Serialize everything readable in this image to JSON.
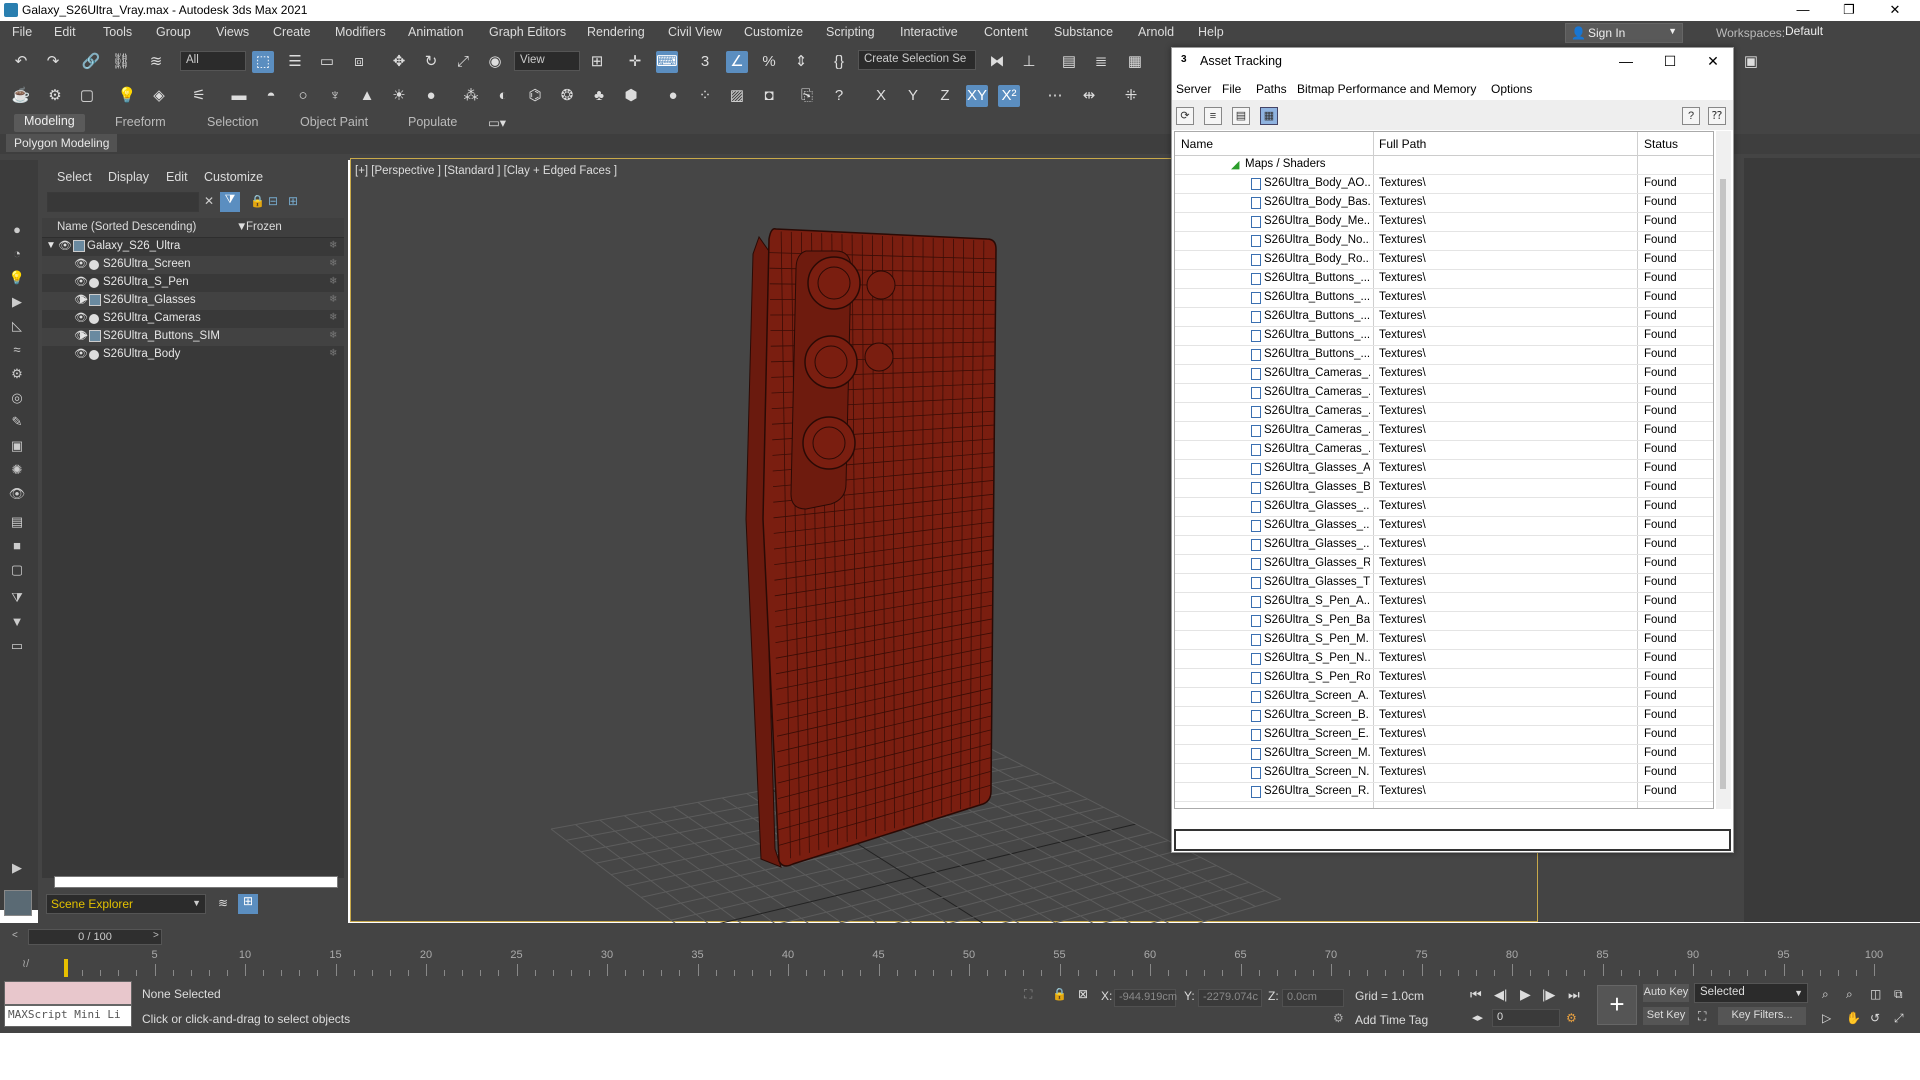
{
  "window": {
    "title": "Galaxy_S26Ultra_Vray.max - Autodesk 3ds Max 2021",
    "minimize": "—",
    "restore": "❐",
    "close": "✕"
  },
  "menu": [
    "File",
    "Edit",
    "Tools",
    "Group",
    "Views",
    "Create",
    "Modifiers",
    "Animation",
    "Graph Editors",
    "Rendering",
    "Civil View",
    "Customize",
    "Scripting",
    "Interactive",
    "Content",
    "Substance",
    "Arnold",
    "Help"
  ],
  "signin": "Sign In",
  "workspaces_label": "Workspaces:",
  "workspaces_value": "Default",
  "toolbar": {
    "filter_all": "All",
    "view_dd": "View",
    "selection_set": "Create Selection Se"
  },
  "ribbon_tabs": [
    "Modeling",
    "Freeform",
    "Selection",
    "Object Paint",
    "Populate"
  ],
  "ribbon_sub": "Polygon Modeling",
  "scene_explorer": {
    "menu": [
      "Select",
      "Display",
      "Edit",
      "Customize"
    ],
    "col_name": "Name (Sorted Descending)",
    "col_frozen": "Frozen",
    "rows": [
      {
        "label": "Galaxy_S26_Ultra",
        "level": 0,
        "expand": "▼",
        "type": "grp"
      },
      {
        "label": "S26Ultra_Screen",
        "level": 1,
        "type": "obj"
      },
      {
        "label": "S26Ultra_S_Pen",
        "level": 1,
        "type": "obj"
      },
      {
        "label": "S26Ultra_Glasses",
        "level": 1,
        "expand": "▶",
        "type": "grp"
      },
      {
        "label": "S26Ultra_Cameras",
        "level": 1,
        "type": "obj"
      },
      {
        "label": "S26Ultra_Buttons_SIM",
        "level": 1,
        "expand": "▶",
        "type": "grp"
      },
      {
        "label": "S26Ultra_Body",
        "level": 1,
        "type": "obj"
      }
    ],
    "footer": "Scene Explorer"
  },
  "viewport": {
    "label": "[+] [Perspective ] [Standard ] [Clay + Edged Faces ]"
  },
  "asset": {
    "title": "Asset Tracking",
    "menu": [
      "Server",
      "File",
      "Paths",
      "Bitmap Performance and Memory",
      "Options"
    ],
    "columns": [
      "Name",
      "Full Path",
      "Status"
    ],
    "group": "Maps / Shaders",
    "rows": [
      [
        "S26Ultra_Body_AO...",
        "Textures\\",
        "Found"
      ],
      [
        "S26Ultra_Body_Bas...",
        "Textures\\",
        "Found"
      ],
      [
        "S26Ultra_Body_Me...",
        "Textures\\",
        "Found"
      ],
      [
        "S26Ultra_Body_No...",
        "Textures\\",
        "Found"
      ],
      [
        "S26Ultra_Body_Ro...",
        "Textures\\",
        "Found"
      ],
      [
        "S26Ultra_Buttons_...",
        "Textures\\",
        "Found"
      ],
      [
        "S26Ultra_Buttons_...",
        "Textures\\",
        "Found"
      ],
      [
        "S26Ultra_Buttons_...",
        "Textures\\",
        "Found"
      ],
      [
        "S26Ultra_Buttons_...",
        "Textures\\",
        "Found"
      ],
      [
        "S26Ultra_Buttons_...",
        "Textures\\",
        "Found"
      ],
      [
        "S26Ultra_Cameras_...",
        "Textures\\",
        "Found"
      ],
      [
        "S26Ultra_Cameras_...",
        "Textures\\",
        "Found"
      ],
      [
        "S26Ultra_Cameras_...",
        "Textures\\",
        "Found"
      ],
      [
        "S26Ultra_Cameras_...",
        "Textures\\",
        "Found"
      ],
      [
        "S26Ultra_Cameras_...",
        "Textures\\",
        "Found"
      ],
      [
        "S26Ultra_Glasses_A...",
        "Textures\\",
        "Found"
      ],
      [
        "S26Ultra_Glasses_B...",
        "Textures\\",
        "Found"
      ],
      [
        "S26Ultra_Glasses_...",
        "Textures\\",
        "Found"
      ],
      [
        "S26Ultra_Glasses_...",
        "Textures\\",
        "Found"
      ],
      [
        "S26Ultra_Glasses_...",
        "Textures\\",
        "Found"
      ],
      [
        "S26Ultra_Glasses_R...",
        "Textures\\",
        "Found"
      ],
      [
        "S26Ultra_Glasses_T...",
        "Textures\\",
        "Found"
      ],
      [
        "S26Ultra_S_Pen_A...",
        "Textures\\",
        "Found"
      ],
      [
        "S26Ultra_S_Pen_Ba...",
        "Textures\\",
        "Found"
      ],
      [
        "S26Ultra_S_Pen_M...",
        "Textures\\",
        "Found"
      ],
      [
        "S26Ultra_S_Pen_N...",
        "Textures\\",
        "Found"
      ],
      [
        "S26Ultra_S_Pen_Ro...",
        "Textures\\",
        "Found"
      ],
      [
        "S26Ultra_Screen_A...",
        "Textures\\",
        "Found"
      ],
      [
        "S26Ultra_Screen_B...",
        "Textures\\",
        "Found"
      ],
      [
        "S26Ultra_Screen_E...",
        "Textures\\",
        "Found"
      ],
      [
        "S26Ultra_Screen_M...",
        "Textures\\",
        "Found"
      ],
      [
        "S26Ultra_Screen_N...",
        "Textures\\",
        "Found"
      ],
      [
        "S26Ultra_Screen_R...",
        "Textures\\",
        "Found"
      ]
    ]
  },
  "timeslider": "0 / 100",
  "ticks": [
    0,
    5,
    10,
    15,
    20,
    25,
    30,
    35,
    40,
    45,
    50,
    55,
    60,
    65,
    70,
    75,
    80,
    85,
    90,
    95,
    100
  ],
  "status": {
    "maxscript": "MAXScript Mini Li",
    "selected": "None Selected",
    "prompt": "Click or click-and-drag to select objects",
    "x_label": "X:",
    "x": "-944.919cm",
    "y_label": "Y:",
    "y": "-2279.074c",
    "z_label": "Z:",
    "z": "0.0cm",
    "grid": "Grid = 1.0cm",
    "addtime": "Add Time Tag",
    "frame": "0",
    "autokey": "Auto Key",
    "selected_dd": "Selected",
    "setkey": "Set Key",
    "keyfilters": "Key Filters..."
  },
  "colors": {
    "mesh": "#7a1e10",
    "wire": "#2a0a05",
    "accent": "#5b8ec0"
  }
}
